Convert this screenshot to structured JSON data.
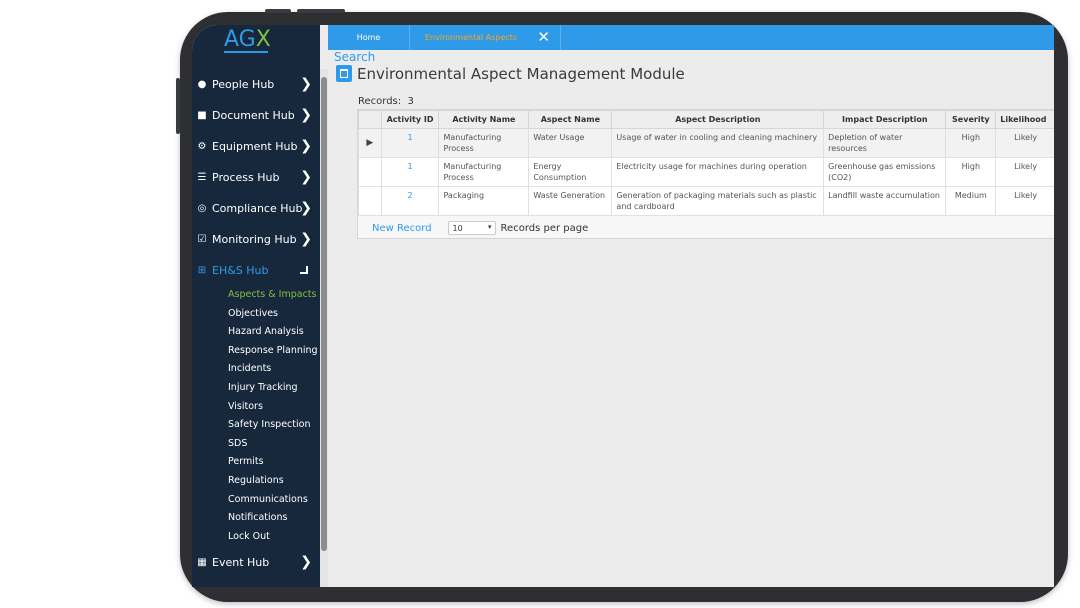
{
  "app": {
    "logo_a": "A",
    "logo_g": "G",
    "logo_x": "X"
  },
  "sidebar": {
    "hubs": [
      {
        "label": "People Hub",
        "icon": "user-icon"
      },
      {
        "label": "Document Hub",
        "icon": "folder-icon"
      },
      {
        "label": "Equipment Hub",
        "icon": "gears-icon"
      },
      {
        "label": "Process Hub",
        "icon": "list-icon"
      },
      {
        "label": "Compliance Hub",
        "icon": "target-icon"
      },
      {
        "label": "Monitoring Hub",
        "icon": "checkbox-icon"
      },
      {
        "label": "EH&S Hub",
        "icon": "plus-square-icon"
      },
      {
        "label": "Event Hub",
        "icon": "calendar-icon"
      }
    ],
    "ehs_items": [
      "Aspects & Impacts",
      "Objectives",
      "Hazard Analysis",
      "Response Planning",
      "Incidents",
      "Injury Tracking",
      "Visitors",
      "Safety Inspection",
      "SDS",
      "Permits",
      "Regulations",
      "Communications",
      "Notifications",
      "Lock Out"
    ],
    "active_item": "Aspects & Impacts"
  },
  "tabs": {
    "home": "Home",
    "active": "Environmental Aspects",
    "close_glyph": "✕"
  },
  "content": {
    "search_link": "Search",
    "title": "Environmental Aspect Management Module",
    "records_label": "Records:",
    "records_count": "3",
    "new_record": "New Record",
    "page_size": "10",
    "records_per_page": "Records per page"
  },
  "grid": {
    "columns": [
      "Activity ID",
      "Activity Name",
      "Aspect Name",
      "Aspect Description",
      "Impact Description",
      "Severity",
      "Likelihood"
    ],
    "rows": [
      {
        "id": "1",
        "activity": "Manufacturing Process",
        "aspect": "Water Usage",
        "aspect_desc": "Usage of water in cooling and cleaning machinery",
        "impact": "Depletion of water resources",
        "severity": "High",
        "likelihood": "Likely"
      },
      {
        "id": "1",
        "activity": "Manufacturing Process",
        "aspect": "Energy Consumption",
        "aspect_desc": "Electricity usage for machines during operation",
        "impact": "Greenhouse gas emissions (CO2)",
        "severity": "High",
        "likelihood": "Likely"
      },
      {
        "id": "2",
        "activity": "Packaging",
        "aspect": "Waste Generation",
        "aspect_desc": "Generation of packaging materials such as plastic and cardboard",
        "impact": "Landfill waste accumulation",
        "severity": "Medium",
        "likelihood": "Likely"
      }
    ]
  },
  "colors": {
    "sidebar_bg": "#17283c",
    "accent_blue": "#2f9be8",
    "accent_green": "#7ec242",
    "tab_orange": "#f5a623"
  }
}
